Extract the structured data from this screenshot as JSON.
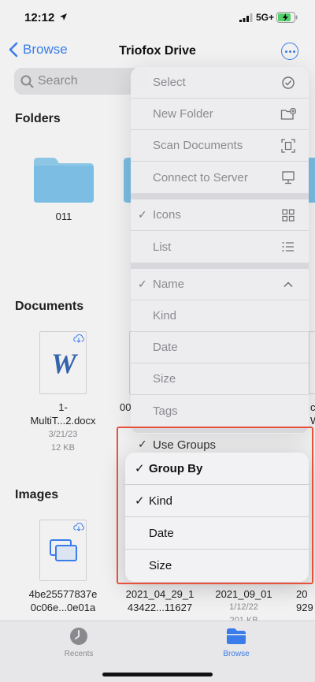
{
  "status_bar": {
    "time": "12:12",
    "carrier": "5G+"
  },
  "nav": {
    "back_label": "Browse",
    "title": "Triofox Drive"
  },
  "search": {
    "placeholder": "Search"
  },
  "sections": {
    "folders": "Folders",
    "documents": "Documents",
    "images": "Images"
  },
  "folders": [
    {
      "name": "011"
    }
  ],
  "documents": [
    {
      "name_line1": "1-",
      "name_line2": "MultiT...2.docx",
      "date": "3/21/23",
      "size": "12 KB"
    }
  ],
  "images": [
    {
      "name_line1": "4be25577837e",
      "name_line2": "0c06e...0e01a"
    },
    {
      "name_line1": "2021_04_29_1",
      "name_line2": "43422...11627"
    },
    {
      "name_line1": "2021_09_01",
      "date": "1/12/22",
      "size": "201 KB"
    },
    {
      "name_line1": "20",
      "name_line2": "929"
    }
  ],
  "partial_labels": {
    "doc_col2": "00",
    "doc_col4a": "c",
    "doc_col4b": "W"
  },
  "menu": {
    "actions": [
      {
        "label": "Select",
        "icon": "checkmark-circle-icon"
      },
      {
        "label": "New Folder",
        "icon": "folder-plus-icon"
      },
      {
        "label": "Scan Documents",
        "icon": "scan-doc-icon"
      },
      {
        "label": "Connect to Server",
        "icon": "monitor-icon"
      }
    ],
    "view": [
      {
        "label": "Icons",
        "checked": true,
        "icon": "grid-icon"
      },
      {
        "label": "List",
        "checked": false,
        "icon": "list-icon"
      }
    ],
    "sort": [
      {
        "label": "Name",
        "checked": true,
        "icon": "chevron-up-icon"
      },
      {
        "label": "Kind",
        "checked": false
      },
      {
        "label": "Date",
        "checked": false
      },
      {
        "label": "Size",
        "checked": false
      },
      {
        "label": "Tags",
        "checked": false
      }
    ],
    "use_groups": {
      "label": "Use Groups",
      "checked": true
    }
  },
  "group_by": {
    "title": "Group By",
    "options": [
      {
        "label": "Kind",
        "checked": true
      },
      {
        "label": "Date",
        "checked": false
      },
      {
        "label": "Size",
        "checked": false
      }
    ]
  },
  "tabs": [
    {
      "label": "Recents",
      "active": false
    },
    {
      "label": "Browse",
      "active": true
    }
  ],
  "colors": {
    "accent": "#2f7cf6",
    "folder": "#7cc4ec",
    "highlight": "#e8503a"
  }
}
